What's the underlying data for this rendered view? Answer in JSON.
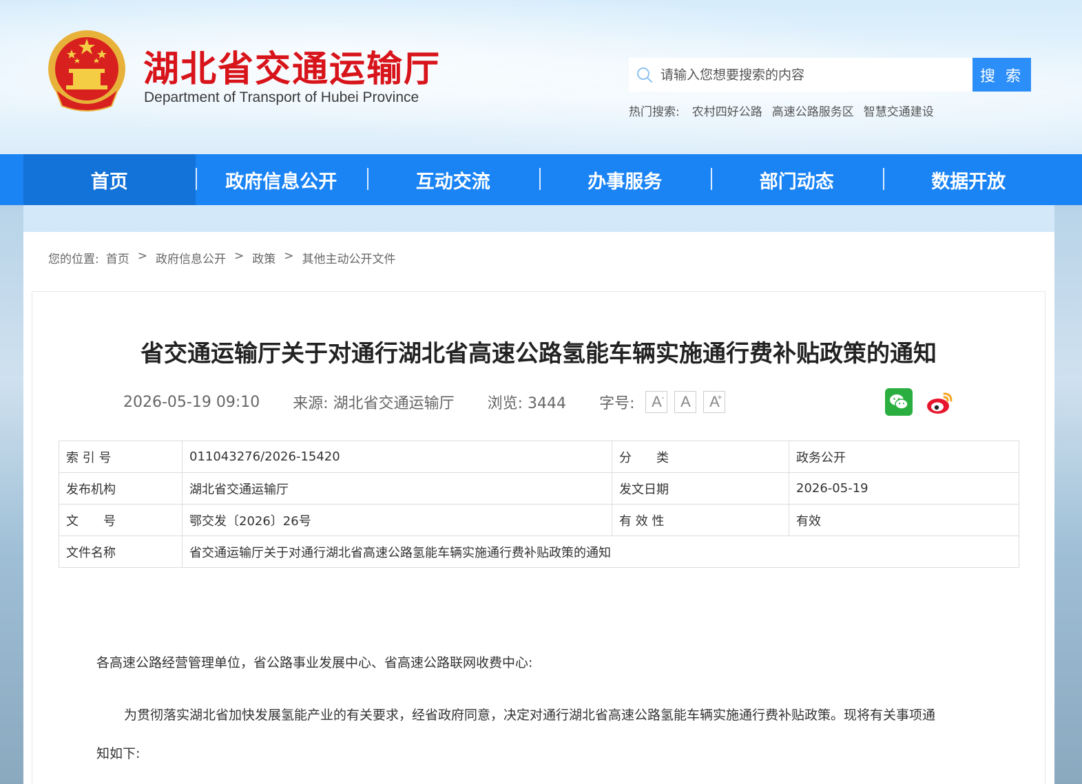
{
  "site": {
    "title": "湖北省交通运输厅",
    "subtitle": "Department of Transport of Hubei Province"
  },
  "search": {
    "placeholder": "请输入您想要搜索的内容",
    "button": "搜 索",
    "hot_label": "热门搜索:",
    "hot_items": [
      "农村四好公路",
      "高速公路服务区",
      "智慧交通建设"
    ]
  },
  "nav": {
    "items": [
      "首页",
      "政府信息公开",
      "互动交流",
      "办事服务",
      "部门动态",
      "数据开放"
    ]
  },
  "breadcrumb": {
    "label": "您的位置:",
    "items": [
      "首页",
      "政府信息公开",
      "政策",
      "其他主动公开文件"
    ],
    "separator": ">"
  },
  "article": {
    "title": "省交通运输厅关于对通行湖北省高速公路氢能车辆实施通行费补贴政策的通知",
    "datetime": "2026-05-19 09:10",
    "source": "来源: 湖北省交通运输厅",
    "views": "浏览: 3444",
    "font_label": "字号:",
    "font_buttons": [
      "A",
      "A",
      "A"
    ],
    "font_minus": "-",
    "font_plus": "+"
  },
  "info_table": {
    "rows": [
      {
        "k1": "索 引 号",
        "v1": "011043276/2026-15420",
        "k2": "分　　类",
        "v2": "政务公开"
      },
      {
        "k1": "发布机构",
        "v1": "湖北省交通运输厅",
        "k2": "发文日期",
        "v2": "2026-05-19"
      },
      {
        "k1": "文　　号",
        "v1": "鄂交发〔2026〕26号",
        "k2": "有 效 性",
        "v2": "有效"
      }
    ],
    "name_label": "文件名称",
    "name_value": "省交通运输厅关于对通行湖北省高速公路氢能车辆实施通行费补贴政策的通知"
  },
  "body": {
    "greeting": "各高速公路经营管理单位，省公路事业发展中心、省高速公路联网收费中心:",
    "para1_line1": "为贯彻落实湖北省加快发展氢能产业的有关要求，经省政府同意，决定对通行湖北省高速公路氢能车辆实施通行费补贴政策。现将有关事项通",
    "para1_line2": "知如下:"
  },
  "colors": {
    "nav_bg": "#1a84f5",
    "nav_active": "#1473d8",
    "title_red": "#d8141b",
    "search_button": "#2c8ef8"
  }
}
